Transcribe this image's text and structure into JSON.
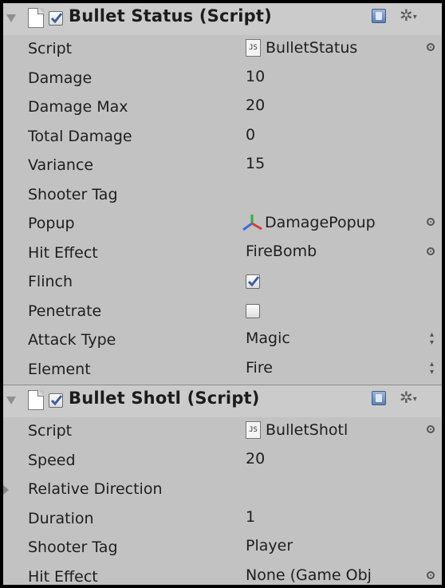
{
  "components": [
    {
      "title": "Bullet Status (Script)",
      "enabled": true,
      "rows": [
        {
          "label": "Script",
          "kind": "script",
          "value": "BulletStatus"
        },
        {
          "label": "Damage",
          "kind": "text",
          "value": "10"
        },
        {
          "label": "Damage Max",
          "kind": "text",
          "value": "20"
        },
        {
          "label": "Total Damage",
          "kind": "text",
          "value": "0"
        },
        {
          "label": "Variance",
          "kind": "text",
          "value": "15"
        },
        {
          "label": "Shooter Tag",
          "kind": "text",
          "value": ""
        },
        {
          "label": "Popup",
          "kind": "prefab",
          "value": "DamagePopup"
        },
        {
          "label": "Hit Effect",
          "kind": "object",
          "value": "FireBomb"
        },
        {
          "label": "Flinch",
          "kind": "checkbox",
          "checked": true
        },
        {
          "label": "Penetrate",
          "kind": "checkbox",
          "checked": false
        },
        {
          "label": "Attack Type",
          "kind": "enum",
          "value": "Magic"
        },
        {
          "label": "Element",
          "kind": "enum",
          "value": "Fire"
        }
      ]
    },
    {
      "title": "Bullet Shotl (Script)",
      "enabled": true,
      "rows": [
        {
          "label": "Script",
          "kind": "script",
          "value": "BulletShotl"
        },
        {
          "label": "Speed",
          "kind": "text",
          "value": "20"
        },
        {
          "label": "Relative Direction",
          "kind": "foldout",
          "value": ""
        },
        {
          "label": "Duration",
          "kind": "text",
          "value": "1"
        },
        {
          "label": "Shooter Tag",
          "kind": "text",
          "value": "Player"
        },
        {
          "label": "Hit Effect",
          "kind": "object",
          "value": "None (Game Obj"
        }
      ]
    }
  ],
  "icons": {
    "help": "help-book-icon",
    "settings": "gear-icon",
    "script_file": "js-script-icon",
    "prefab": "prefab-axes-icon",
    "object_picker": "object-picker-icon"
  },
  "colors": {
    "panel_bg": "#c2c2c2",
    "header_bg": "#cbcbcb",
    "check_mark": "#3a5f9e"
  }
}
